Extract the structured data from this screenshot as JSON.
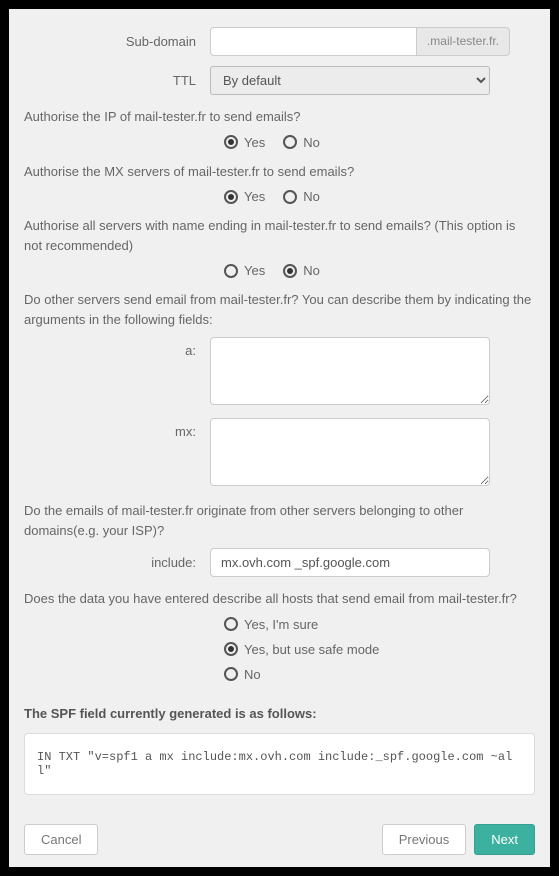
{
  "fields": {
    "subdomain": {
      "label": "Sub-domain",
      "value": "",
      "addon": ".mail-tester.fr."
    },
    "ttl": {
      "label": "TTL",
      "value": "By default"
    },
    "a": {
      "label": "a:",
      "value": ""
    },
    "mx": {
      "label": "mx:",
      "value": ""
    },
    "include": {
      "label": "include:",
      "value": "mx.ovh.com _spf.google.com"
    }
  },
  "questions": {
    "auth_ip": {
      "text": "Authorise the IP of mail-tester.fr to send emails?",
      "options": {
        "yes": "Yes",
        "no": "No"
      },
      "selected": "yes"
    },
    "auth_mx": {
      "text": "Authorise the MX servers of mail-tester.fr to send emails?",
      "options": {
        "yes": "Yes",
        "no": "No"
      },
      "selected": "yes"
    },
    "auth_all": {
      "text": "Authorise all servers with name ending in mail-tester.fr to send emails? (This option is not recommended)",
      "options": {
        "yes": "Yes",
        "no": "No"
      },
      "selected": "no"
    },
    "other_servers": {
      "text": "Do other servers send email from mail-tester.fr? You can describe them by indicating the arguments in the following fields:"
    },
    "other_domains": {
      "text": "Do the emails of mail-tester.fr originate from other servers belonging to other domains(e.g. your ISP)?"
    },
    "all_hosts": {
      "text": "Does the data you have entered describe all hosts that send email from mail-tester.fr?",
      "options": {
        "sure": "Yes, I'm sure",
        "safe": "Yes, but use safe mode",
        "no": "No"
      },
      "selected": "safe"
    }
  },
  "generated": {
    "heading": "The SPF field currently generated is as follows:",
    "value": "IN TXT \"v=spf1 a mx include:mx.ovh.com include:_spf.google.com ~all\""
  },
  "buttons": {
    "cancel": "Cancel",
    "previous": "Previous",
    "next": "Next"
  }
}
